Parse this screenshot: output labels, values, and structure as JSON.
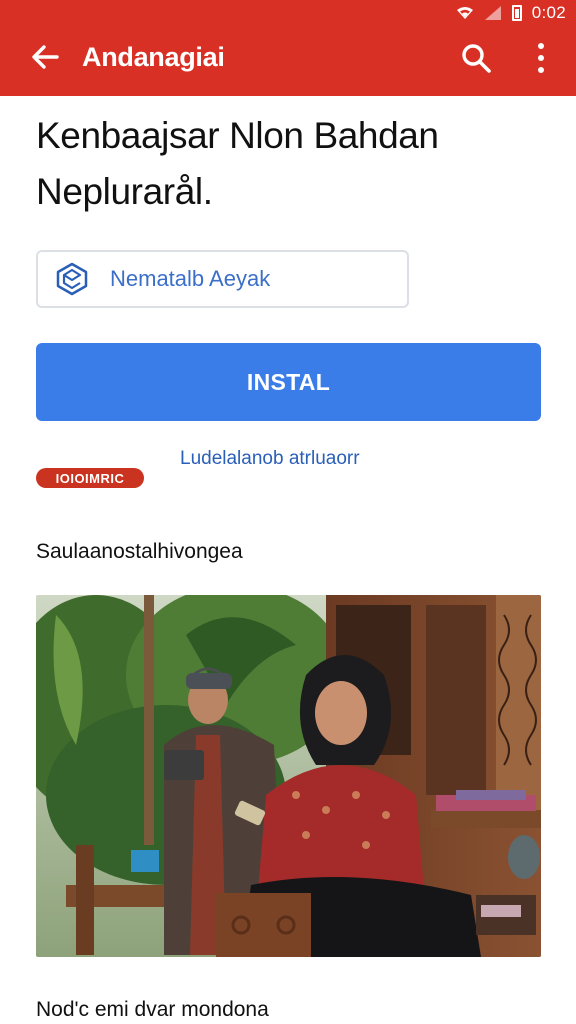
{
  "status_bar": {
    "time": "0:02"
  },
  "app_bar": {
    "title": "Andanagiai"
  },
  "page": {
    "title": "Kenbaajsar Nlon Bahdan Neplurarål.",
    "account_field_text": "Nematalb Aeyak",
    "install_label": "INSTAL",
    "info_link": "Ludelalanob atrluaorr",
    "badge_text": "IOIOIMRIC",
    "section_title": "Saulaanostalhivongea",
    "bottom_text": "Nod'c emi dvar mondona"
  },
  "colors": {
    "header": "#d93025",
    "primary_button": "#3b7de8",
    "link": "#2a5fb8",
    "badge": "#c9331f"
  }
}
